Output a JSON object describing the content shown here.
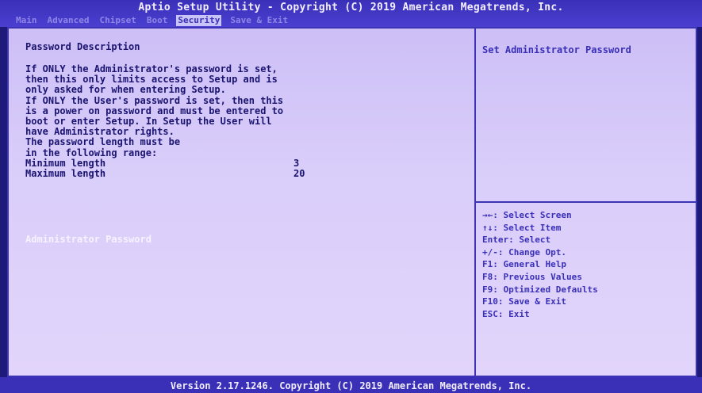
{
  "header": {
    "title": "Aptio Setup Utility - Copyright (C) 2019 American Megatrends, Inc.",
    "tabs": [
      {
        "label": "Main"
      },
      {
        "label": "Advanced"
      },
      {
        "label": "Chipset"
      },
      {
        "label": "Boot"
      },
      {
        "label": "Security"
      },
      {
        "label": "Save & Exit"
      }
    ],
    "active_tab": "Security"
  },
  "left_panel": {
    "heading": "Password Description",
    "description_lines": [
      "If ONLY the Administrator's password is set,",
      "then this only limits access to Setup and is",
      "only asked for when entering Setup.",
      "If ONLY the User's password is set, then this",
      "is a power on password and must be entered to",
      "boot or enter Setup. In Setup the User will",
      "have Administrator rights.",
      "The password length must be",
      "in the following range:"
    ],
    "min_label": "Minimum length",
    "min_value": "3",
    "max_label": "Maximum length",
    "max_value": "20",
    "selected_item": "Administrator Password"
  },
  "right_panel": {
    "help_title": "Set Administrator Password",
    "keys": [
      "→←: Select Screen",
      "↑↓: Select Item",
      "Enter: Select",
      "+/-: Change Opt.",
      "F1: General Help",
      "F8: Previous Values",
      "F9: Optimized Defaults",
      "F10: Save & Exit",
      "ESC: Exit"
    ]
  },
  "footer": {
    "version": "Version 2.17.1246. Copyright (C) 2019 American Megatrends, Inc."
  }
}
